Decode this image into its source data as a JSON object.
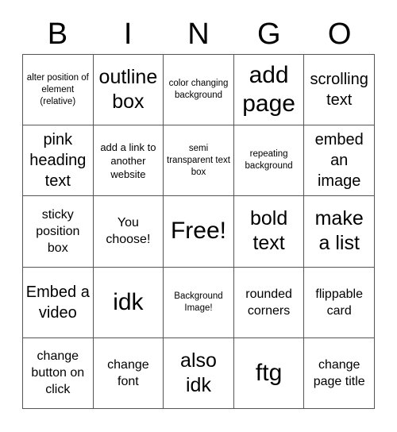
{
  "card": {
    "title_letters": [
      "B",
      "I",
      "N",
      "G",
      "O"
    ],
    "columns": 5,
    "rows": 5,
    "border_color": "#555555",
    "text_color": "#000000",
    "background_color": "#ffffff",
    "free_space_label": "Free!",
    "free_space_index": 12,
    "cells": [
      {
        "label": "alter position of element (relative)",
        "size": "xs"
      },
      {
        "label": "outline box",
        "size": "xl"
      },
      {
        "label": "color changing background",
        "size": "xs"
      },
      {
        "label": "add page",
        "size": "xxl"
      },
      {
        "label": "scrolling text",
        "size": "l"
      },
      {
        "label": "pink heading text",
        "size": "l"
      },
      {
        "label": "add a link to another website",
        "size": "s"
      },
      {
        "label": "semi transparent text box",
        "size": "xs"
      },
      {
        "label": "repeating background",
        "size": "xs"
      },
      {
        "label": "embed an image",
        "size": "l"
      },
      {
        "label": "sticky position box",
        "size": "m"
      },
      {
        "label": "You choose!",
        "size": "m"
      },
      {
        "label": "Free!",
        "size": "xxl"
      },
      {
        "label": "bold text",
        "size": "xl"
      },
      {
        "label": "make a list",
        "size": "xl"
      },
      {
        "label": "Embed a video",
        "size": "l"
      },
      {
        "label": "idk",
        "size": "xxl"
      },
      {
        "label": "Background Image!",
        "size": "xs"
      },
      {
        "label": "rounded corners",
        "size": "m"
      },
      {
        "label": "flippable card",
        "size": "m"
      },
      {
        "label": "change button on click",
        "size": "m"
      },
      {
        "label": "change font",
        "size": "m"
      },
      {
        "label": "also idk",
        "size": "xl"
      },
      {
        "label": "ftg",
        "size": "xxl"
      },
      {
        "label": "change page title",
        "size": "m"
      }
    ]
  }
}
